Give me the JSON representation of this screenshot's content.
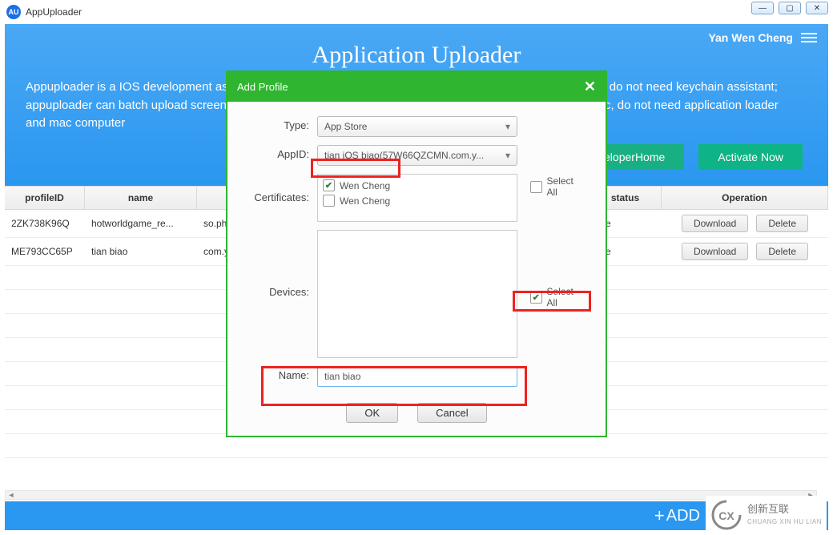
{
  "window": {
    "title": "AppUploader",
    "logo_text": "AU"
  },
  "banner": {
    "user": "Yan Wen Cheng",
    "title": "Application Uploader",
    "desc": "Appuploader is a IOS development assistant, can help you quickly release your application, create certificate, do not need keychain assistant; appuploader can batch upload screenshots and publish the application to apple store in windows, linux or mac, do not need application loader and mac computer",
    "btn_home": "DeveloperHome",
    "btn_activate": "Activate Now"
  },
  "table": {
    "headers": {
      "id": "profileID",
      "name": "name",
      "bundle": "",
      "status": "status",
      "op": "Operation"
    },
    "rows": [
      {
        "id": "2ZK738K96Q",
        "name": "hotworldgame_re...",
        "bundle": "so.phone",
        "status": "tive"
      },
      {
        "id": "ME793CC65P",
        "name": "tian biao",
        "bundle": "com.yesg",
        "status": "tive"
      }
    ],
    "download": "Download",
    "delete": "Delete"
  },
  "modal": {
    "title": "Add Profile",
    "type_label": "Type:",
    "type_value": "App Store",
    "appid_label": "AppID:",
    "appid_value": "tian iOS biao(57W66QZCMN.com.y...",
    "certs_label": "Certificates:",
    "cert1": "Wen Cheng",
    "cert2": "Wen Cheng",
    "selectall": "Select All",
    "devices_label": "Devices:",
    "name_label": "Name:",
    "name_value": "tian biao",
    "ok": "OK",
    "cancel": "Cancel"
  },
  "footer": {
    "add": "ADD"
  },
  "watermark": {
    "cn": "创新互联",
    "en": "CHUANG XIN HU LIAN"
  }
}
